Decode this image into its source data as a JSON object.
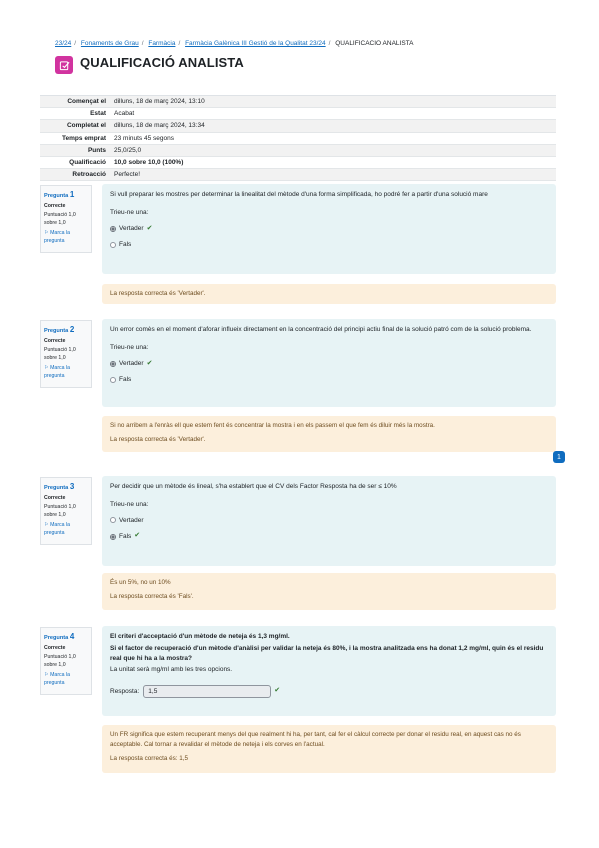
{
  "breadcrumb": {
    "items": [
      "23/24",
      "Fonaments de Grau",
      "Farmàcia",
      "Farmàcia Galènica III Gestió de la Qualitat 23/24"
    ],
    "current": "QUALIFICACIÓ ANALISTA"
  },
  "header": {
    "title": "QUALIFICACIÓ ANALISTA",
    "icon": "quiz-icon",
    "icon_color": "#d1339f"
  },
  "summary": [
    {
      "key": "Començat el",
      "value": "dilluns, 18 de març 2024, 13:10"
    },
    {
      "key": "Estat",
      "value": "Acabat"
    },
    {
      "key": "Completat el",
      "value": "dilluns, 18 de març 2024, 13:34"
    },
    {
      "key": "Temps emprat",
      "value": "23 minuts 45 segons"
    },
    {
      "key": "Punts",
      "value": "25,0/25,0"
    },
    {
      "key": "Qualificació",
      "value": "10,0 sobre 10,0 (100%)"
    },
    {
      "key": "Retroacció",
      "value": "Perfecte!"
    }
  ],
  "questions": [
    {
      "label": "Pregunta",
      "number": "1",
      "state": "Correcte",
      "grade": "Puntuació 1,0 sobre 1,0",
      "flag": "Marca la pregunta",
      "text": "Si vull preparar les mostres per determinar la linealitat del mètode d'una forma simplificada, ho podré fer a partir d'una solució mare",
      "prompt": "Trieu-ne una:",
      "options": [
        {
          "label": "Vertader",
          "selected": true,
          "correct": true
        },
        {
          "label": "Fals",
          "selected": false,
          "correct": false
        }
      ],
      "feedback": "",
      "right_answer": "La resposta correcta és 'Vertader'."
    },
    {
      "label": "Pregunta",
      "number": "2",
      "state": "Correcte",
      "grade": "Puntuació 1,0 sobre 1,0",
      "flag": "Marca la pregunta",
      "text": "Un error comès en el moment d'aforar influeix directament en la concentració del principi actiu final de la solució patró com de la solució problema.",
      "prompt": "Trieu-ne una:",
      "options": [
        {
          "label": "Vertader",
          "selected": true,
          "correct": true
        },
        {
          "label": "Fals",
          "selected": false,
          "correct": false
        }
      ],
      "feedback": "Si no arribem a l'enràs ell que estem fent és concentrar la mostra i en els passem el que fem és diluir més la mostra.",
      "right_answer": "La resposta correcta és 'Vertader'."
    },
    {
      "label": "Pregunta",
      "number": "3",
      "state": "Correcte",
      "grade": "Puntuació 1,0 sobre 1,0",
      "flag": "Marca la pregunta",
      "text": "Per decidir que un mètode és lineal, s'ha establert que el CV dels Factor Resposta ha de ser ≤ 10%",
      "prompt": "Trieu-ne una:",
      "options": [
        {
          "label": "Vertader",
          "selected": false,
          "correct": false
        },
        {
          "label": "Fals",
          "selected": true,
          "correct": true
        }
      ],
      "feedback": "És un 5%, no un 10%",
      "right_answer": "La resposta correcta és 'Fals'."
    },
    {
      "label": "Pregunta",
      "number": "4",
      "state": "Correcte",
      "grade": "Puntuació 1,0 sobre 1,0",
      "flag": "Marca la pregunta",
      "text": "El criteri d'acceptació d'un mètode de neteja és 1,3 mg/ml.",
      "text2": "Si el factor de recuperació d'un mètode d'anàlisi per validar la neteja és 80%, i la mostra analitzada ens ha donat 1,2 mg/ml, quin és el residu real que hi ha a la mostra?",
      "text3": "La unitat serà mg/ml amb les tres opcions.",
      "answer_label": "Resposta:",
      "answer_value": "1,5",
      "feedback": "Un FR significa que estem recuperant menys del que realment hi ha, per tant, cal fer el càlcul correcte per donar el residu real, en aquest cas no és acceptable. Cal tornar a revalidar el mètode de neteja i els corves en l'actual.",
      "right_answer": "La resposta correcta és: 1,5"
    }
  ],
  "side_badge": "1"
}
